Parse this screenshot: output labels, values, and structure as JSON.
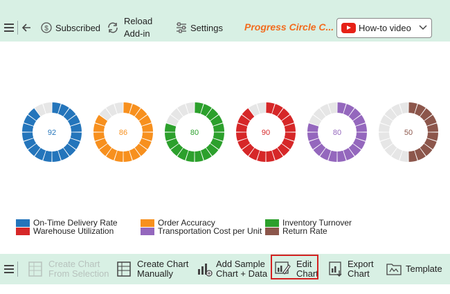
{
  "toolbar": {
    "subscribed_label": "Subscribed",
    "reload_label_1": "Reload",
    "reload_label_2": "Add-in",
    "settings_label": "Settings",
    "title": "Progress Circle C...",
    "howto_label": "How-to video"
  },
  "bottombar": {
    "create_selection_1": "Create Chart",
    "create_selection_2": "From Selection",
    "create_manual_1": "Create Chart",
    "create_manual_2": "Manually",
    "add_sample_1": "Add Sample",
    "add_sample_2": "Chart + Data",
    "edit_1": "Edit",
    "edit_2": "Chart",
    "export_1": "Export",
    "export_2": "Chart",
    "template": "Template"
  },
  "chart_data": {
    "type": "progress-circle",
    "max": 100,
    "segments": 20,
    "track_color": "#e6e6e6",
    "items": [
      {
        "name": "On-Time Delivery Rate",
        "value": 92,
        "color": "#2475bb"
      },
      {
        "name": "Order Accuracy",
        "value": 86,
        "color": "#f7901e"
      },
      {
        "name": "Inventory Turnover",
        "value": 80,
        "color": "#2ca02c"
      },
      {
        "name": "Warehouse Utilization",
        "value": 90,
        "color": "#d62728"
      },
      {
        "name": "Transportation Cost per Unit",
        "value": 80,
        "color": "#9467bd"
      },
      {
        "name": "Return Rate",
        "value": 50,
        "color": "#8c564b"
      }
    ]
  }
}
